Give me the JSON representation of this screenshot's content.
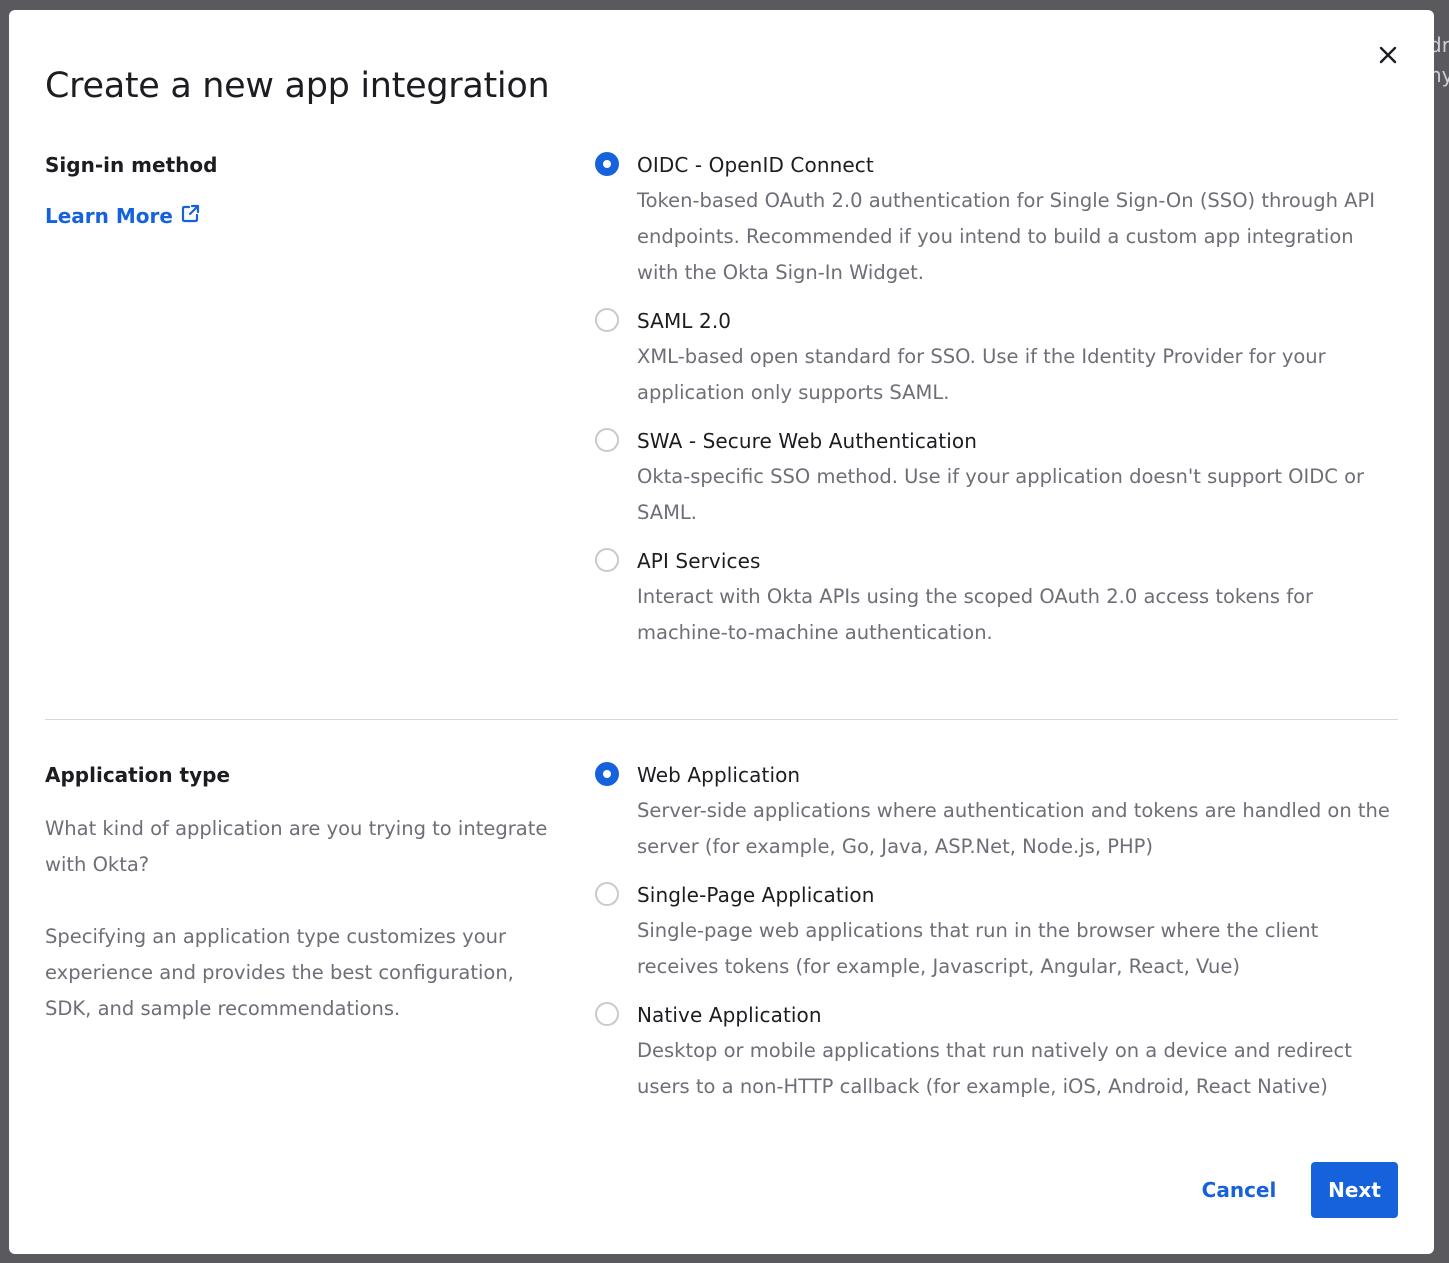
{
  "backdrop": {
    "snippet": "dr ny"
  },
  "modal": {
    "title": "Create a new app integration",
    "close_icon": "close-icon"
  },
  "sign_in": {
    "label": "Sign-in method",
    "learn_more": "Learn More",
    "learn_more_icon": "external-link-icon",
    "options": [
      {
        "label": "OIDC - OpenID Connect",
        "desc": "Token-based OAuth 2.0 authentication for Single Sign-On (SSO) through API endpoints. Recommended if you intend to build a custom app integration with the Okta Sign-In Widget.",
        "selected": true
      },
      {
        "label": "SAML 2.0",
        "desc": "XML-based open standard for SSO. Use if the Identity Provider for your application only supports SAML.",
        "selected": false
      },
      {
        "label": "SWA - Secure Web Authentication",
        "desc": "Okta-specific SSO method. Use if your application doesn't support OIDC or SAML.",
        "selected": false
      },
      {
        "label": "API Services",
        "desc": "Interact with Okta APIs using the scoped OAuth 2.0 access tokens for machine-to-machine authentication.",
        "selected": false
      }
    ]
  },
  "app_type": {
    "label": "Application type",
    "help_1": "What kind of application are you trying to integrate with Okta?",
    "help_2": "Specifying an application type customizes your experience and provides the best configuration, SDK, and sample recommendations.",
    "options": [
      {
        "label": "Web Application",
        "desc": "Server-side applications where authentication and tokens are handled on the server (for example, Go, Java, ASP.Net, Node.js, PHP)",
        "selected": true
      },
      {
        "label": "Single-Page Application",
        "desc": "Single-page web applications that run in the browser where the client receives tokens (for example, Javascript, Angular, React, Vue)",
        "selected": false
      },
      {
        "label": "Native Application",
        "desc": "Desktop or mobile applications that run natively on a device and redirect users to a non-HTTP callback (for example, iOS, Android, React Native)",
        "selected": false
      }
    ]
  },
  "footer": {
    "cancel": "Cancel",
    "next": "Next"
  },
  "colors": {
    "accent": "#1662dd",
    "text": "#1d1d21",
    "muted": "#6e6e78",
    "backdrop": "#5a5a5e"
  }
}
